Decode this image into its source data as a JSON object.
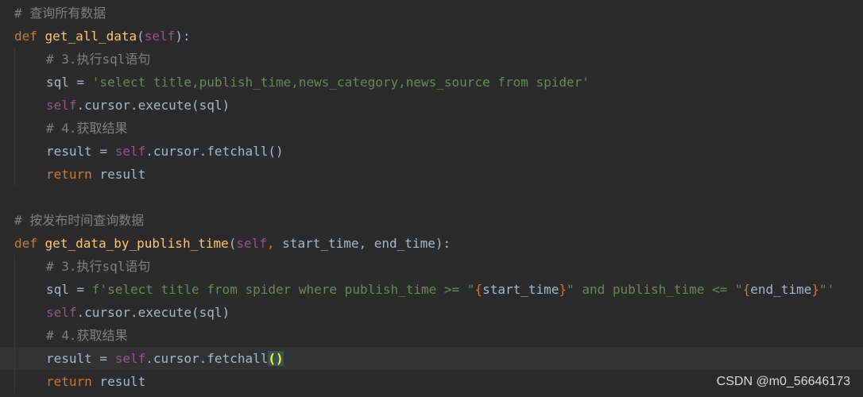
{
  "editor": {
    "comment_all": "# 查询所有数据",
    "def1": {
      "keyword": "def",
      "name": "get_all_data",
      "open": "(",
      "self": "self",
      "close": "):"
    },
    "comment_sql1": "# 3.执行sql语句",
    "sql1": {
      "lhs": "sql = ",
      "string": "'select title,publish_time,news_category,news_source from spider'"
    },
    "exec1": {
      "self": "self",
      "rest": ".cursor.execute(sql)"
    },
    "comment_fetch1": "# 4.获取结果",
    "fetch1": {
      "lhs": "result = ",
      "self": "self",
      "rest": ".cursor.fetchall()"
    },
    "return1": {
      "keyword": "return",
      "rest": " result"
    },
    "comment_by_time": "# 按发布时间查询数据",
    "def2": {
      "keyword": "def",
      "name": "get_data_by_publish_time",
      "open": "(",
      "self": "self",
      "comma": ", ",
      "params": "start_time, end_time",
      "close": "):"
    },
    "comment_sql2": "# 3.执行sql语句",
    "sql2": {
      "lhs": "sql = ",
      "prefix": "f'select title from spider where publish_time >= \"",
      "lbrace1": "{",
      "var1": "start_time",
      "rbrace1": "}",
      "middle": "\" and publish_time <= \"",
      "lbrace2": "{",
      "var2": "end_time",
      "rbrace2": "}",
      "suffix": "\"'"
    },
    "exec2": {
      "self": "self",
      "rest": ".cursor.execute(sql)"
    },
    "comment_fetch2": "# 4.获取结果",
    "fetch2": {
      "lhs": "result = ",
      "self": "self",
      "rest": ".cursor.fetch",
      "rest2": "all",
      "paren_open": "(",
      "paren_close": ")"
    },
    "return2": {
      "keyword": "return",
      "rest": " result"
    }
  },
  "watermark": "CSDN @m0_56646173",
  "colors": {
    "background": "#2b2b2b",
    "comment": "#808080",
    "keyword": "#cc7832",
    "function": "#ffc66d",
    "self": "#94558d",
    "string": "#6a8759",
    "plain": "#a9b7c6"
  }
}
